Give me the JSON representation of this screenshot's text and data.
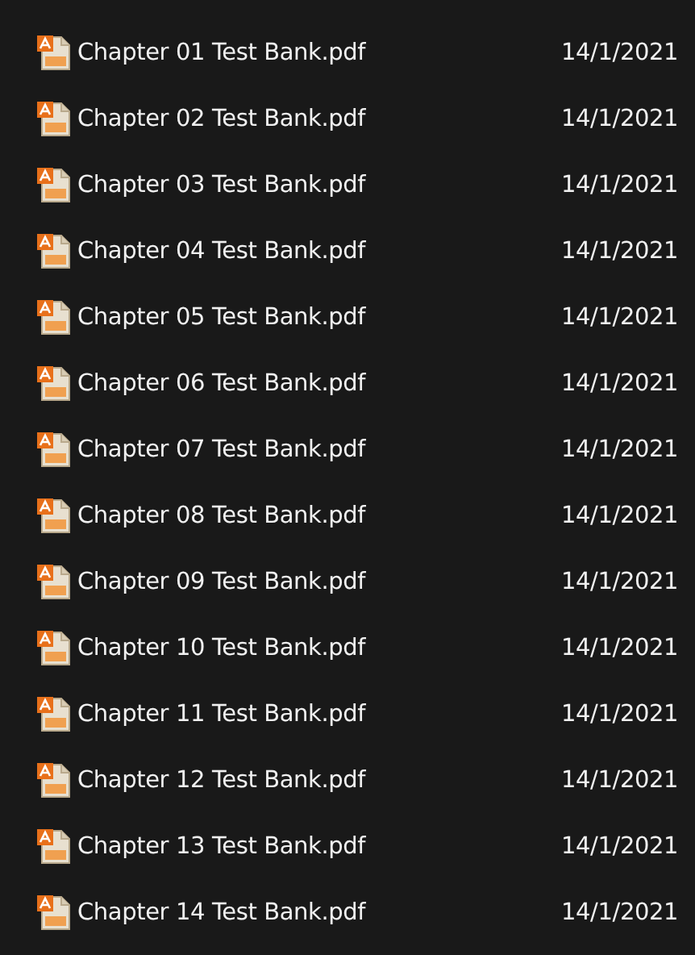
{
  "files": [
    {
      "name": "Chapter 01 Test Bank.pdf",
      "date": "14/1/2021"
    },
    {
      "name": "Chapter 02 Test Bank.pdf",
      "date": "14/1/2021"
    },
    {
      "name": "Chapter 03 Test Bank.pdf",
      "date": "14/1/2021"
    },
    {
      "name": "Chapter 04 Test Bank.pdf",
      "date": "14/1/2021"
    },
    {
      "name": "Chapter 05 Test Bank.pdf",
      "date": "14/1/2021"
    },
    {
      "name": "Chapter 06 Test Bank.pdf",
      "date": "14/1/2021"
    },
    {
      "name": "Chapter 07 Test Bank.pdf",
      "date": "14/1/2021"
    },
    {
      "name": "Chapter 08 Test Bank.pdf",
      "date": "14/1/2021"
    },
    {
      "name": "Chapter 09 Test Bank.pdf",
      "date": "14/1/2021"
    },
    {
      "name": "Chapter 10 Test Bank.pdf",
      "date": "14/1/2021"
    },
    {
      "name": "Chapter 11 Test Bank.pdf",
      "date": "14/1/2021"
    },
    {
      "name": "Chapter 12 Test Bank.pdf",
      "date": "14/1/2021"
    },
    {
      "name": "Chapter 13 Test Bank.pdf",
      "date": "14/1/2021"
    },
    {
      "name": "Chapter 14 Test Bank.pdf",
      "date": "14/1/2021"
    }
  ]
}
